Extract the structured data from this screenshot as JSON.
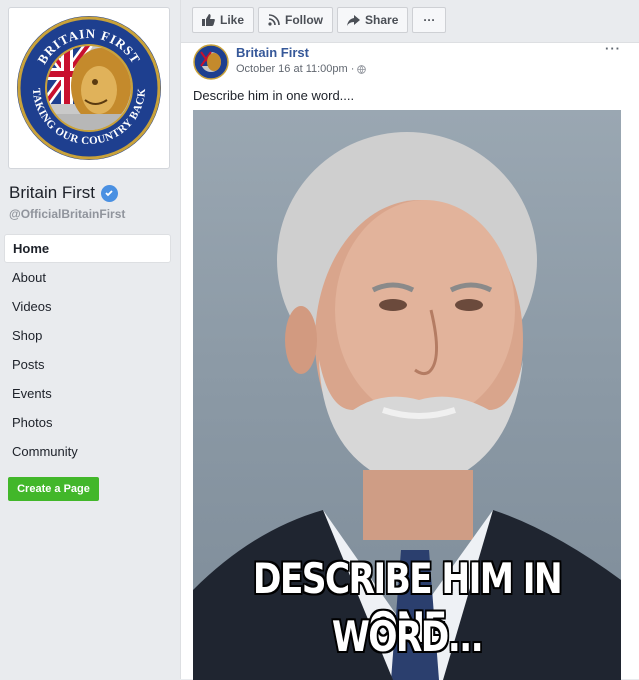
{
  "page": {
    "name": "Britain First",
    "handle": "@OfficialBritainFirst",
    "logo_text_top": "BRITAIN FIRST",
    "logo_text_bottom": "TAKING OUR COUNTRY BACK"
  },
  "sidebar": {
    "items": [
      {
        "label": "Home",
        "active": true
      },
      {
        "label": "About"
      },
      {
        "label": "Videos"
      },
      {
        "label": "Shop"
      },
      {
        "label": "Posts"
      },
      {
        "label": "Events"
      },
      {
        "label": "Photos"
      },
      {
        "label": "Community"
      }
    ],
    "create_page_label": "Create a Page"
  },
  "actionbar": {
    "like_label": "Like",
    "follow_label": "Follow",
    "share_label": "Share",
    "more_label": "···"
  },
  "post": {
    "author": "Britain First",
    "timestamp": "October 16 at 11:00pm",
    "separator": "·",
    "more_label": "···",
    "text": "Describe him in one word....",
    "image_caption_line1": "DESCRIBE HIM IN ONE",
    "image_caption_line2": "WORD..."
  },
  "colors": {
    "link_blue": "#365899",
    "create_green": "#42b72a",
    "verified_blue": "#4a90e2",
    "background": "#e9ebee"
  }
}
